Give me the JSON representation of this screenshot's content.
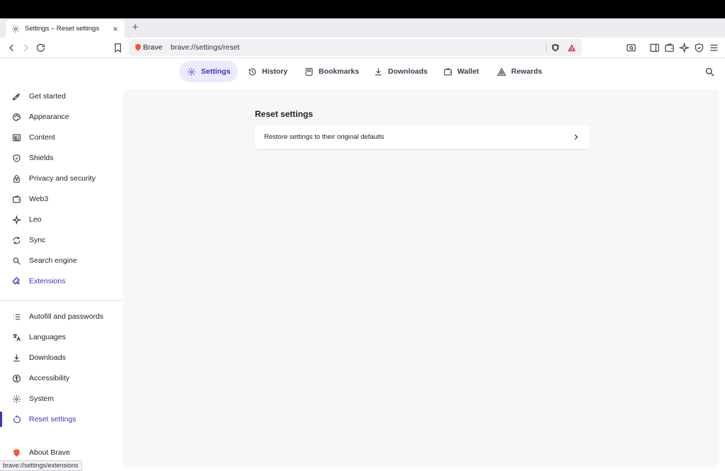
{
  "tab": {
    "title": "Settings – Reset settings",
    "close": "×"
  },
  "newtab": "+",
  "omnibox": {
    "site": "Brave",
    "url": "brave://settings/reset"
  },
  "topnav": [
    {
      "label": "Settings",
      "icon": "gear-icon",
      "active": true
    },
    {
      "label": "History",
      "icon": "history-icon"
    },
    {
      "label": "Bookmarks",
      "icon": "bookmarks-icon"
    },
    {
      "label": "Downloads",
      "icon": "download-icon"
    },
    {
      "label": "Wallet",
      "icon": "wallet-icon"
    },
    {
      "label": "Rewards",
      "icon": "rewards-icon"
    }
  ],
  "sidebar": {
    "items": [
      {
        "label": "Get started",
        "icon": "rocket-icon"
      },
      {
        "label": "Appearance",
        "icon": "palette-icon"
      },
      {
        "label": "Content",
        "icon": "content-icon"
      },
      {
        "label": "Shields",
        "icon": "shield-icon"
      },
      {
        "label": "Privacy and security",
        "icon": "lock-icon"
      },
      {
        "label": "Web3",
        "icon": "wallet-icon"
      },
      {
        "label": "Leo",
        "icon": "sparkle-icon"
      },
      {
        "label": "Sync",
        "icon": "sync-icon"
      },
      {
        "label": "Search engine",
        "icon": "search-icon"
      },
      {
        "label": "Extensions",
        "icon": "puzzle-icon"
      },
      {
        "label": "Autofill and passwords",
        "icon": "list-icon"
      },
      {
        "label": "Languages",
        "icon": "translate-icon"
      },
      {
        "label": "Downloads",
        "icon": "download-icon"
      },
      {
        "label": "Accessibility",
        "icon": "accessibility-icon"
      },
      {
        "label": "System",
        "icon": "gear-icon"
      },
      {
        "label": "Reset settings",
        "icon": "reset-icon"
      },
      {
        "label": "About Brave",
        "icon": "brave-logo-icon"
      }
    ]
  },
  "main": {
    "section_title": "Reset settings",
    "restore_label": "Restore settings to their original defaults"
  },
  "status_url": "brave://settings/extensions",
  "colors": {
    "accent": "#3835ca",
    "accent_bg": "#ebeaff",
    "content_bg": "#f7f7f8",
    "brave_orange": "#fb542b"
  }
}
